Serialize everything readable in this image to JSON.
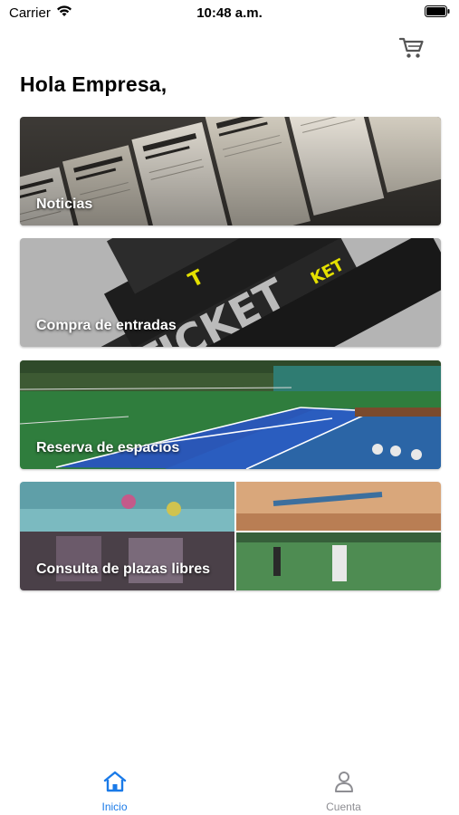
{
  "status_bar": {
    "carrier": "Carrier",
    "time": "10:48 a.m."
  },
  "header": {
    "greeting": "Hola Empresa,",
    "cart_icon": "shopping-cart-icon"
  },
  "cards": [
    {
      "label": "Noticias",
      "image": "newspapers-rack"
    },
    {
      "label": "Compra de entradas",
      "image": "tickets"
    },
    {
      "label": "Reserva de espacios",
      "image": "tennis-courts"
    },
    {
      "label": "Consulta de plazas libres",
      "image": "sports-collage"
    }
  ],
  "tabs": [
    {
      "label": "Inicio",
      "icon": "home-icon",
      "active": true
    },
    {
      "label": "Cuenta",
      "icon": "user-icon",
      "active": false
    }
  ],
  "colors": {
    "active_tab": "#1a7ae8",
    "inactive_tab": "#8e8e93",
    "card_text": "#ffffff"
  }
}
